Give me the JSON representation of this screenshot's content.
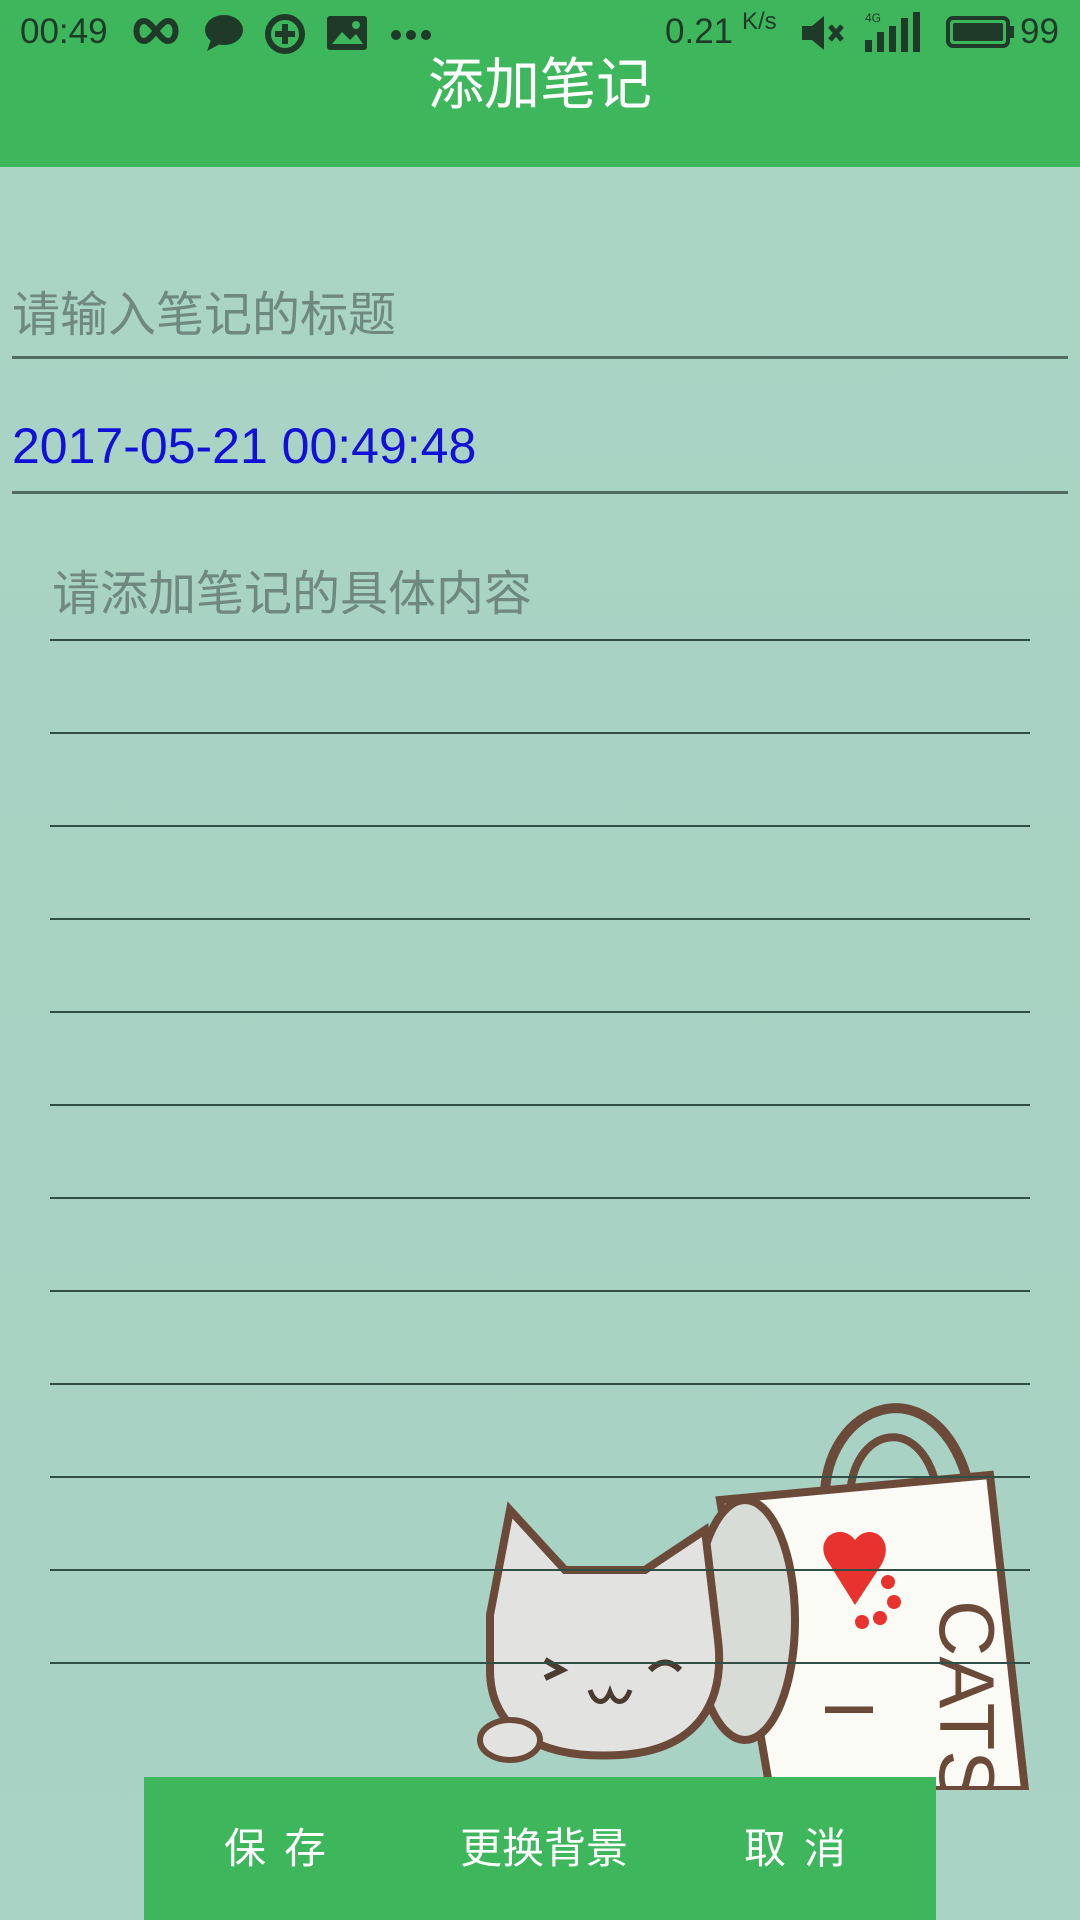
{
  "status_bar": {
    "time": "00:49",
    "network_speed": "0.21",
    "network_speed_unit": "K/s",
    "signal_label": "4G",
    "battery_level": "99",
    "icons": [
      "infinity-icon",
      "chat-bubble-icon",
      "sync-icon",
      "image-icon",
      "more-dots-icon",
      "mute-icon",
      "signal-icon",
      "battery-icon"
    ]
  },
  "app_bar": {
    "title": "添加笔记"
  },
  "form": {
    "title_placeholder": "请输入笔记的标题",
    "date_value": "2017-05-21 00:49:48",
    "content_placeholder": "请添加笔记的具体内容"
  },
  "bottom_bar": {
    "save_label": "保存",
    "change_background_label": "更换背景",
    "cancel_label": "取消"
  },
  "colors": {
    "accent_green": "#3db65c",
    "background": "#a9d3c4",
    "date_text": "#1010d8",
    "rule_line": "#2f4f45"
  }
}
